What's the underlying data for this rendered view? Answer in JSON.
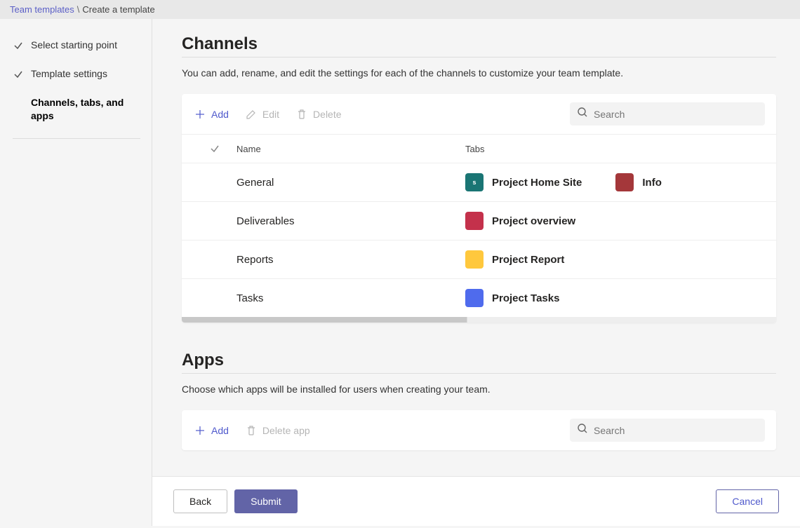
{
  "breadcrumb": {
    "root": "Team templates",
    "separator": "\\",
    "current": "Create a template"
  },
  "sidebar": {
    "steps": [
      {
        "label": "Select starting point",
        "done": true,
        "active": false
      },
      {
        "label": "Template settings",
        "done": true,
        "active": false
      },
      {
        "label": "Channels, tabs, and apps",
        "done": false,
        "active": true
      }
    ]
  },
  "channels": {
    "title": "Channels",
    "description": "You can add, rename, and edit the settings for each of the channels to customize your team template.",
    "toolbar": {
      "add": "Add",
      "edit": "Edit",
      "delete": "Delete",
      "search_placeholder": "Search"
    },
    "columns": {
      "name": "Name",
      "tabs": "Tabs"
    },
    "rows": [
      {
        "name": "General",
        "tabs": [
          {
            "label": "Project Home Site",
            "icon_color": "teal",
            "icon_glyph": "s"
          },
          {
            "label": "Info",
            "icon_color": "brown",
            "icon_glyph": ""
          }
        ]
      },
      {
        "name": "Deliverables",
        "tabs": [
          {
            "label": "Project overview",
            "icon_color": "red",
            "icon_glyph": ""
          }
        ]
      },
      {
        "name": "Reports",
        "tabs": [
          {
            "label": "Project Report",
            "icon_color": "yellow",
            "icon_glyph": ""
          }
        ]
      },
      {
        "name": "Tasks",
        "tabs": [
          {
            "label": "Project Tasks",
            "icon_color": "blue",
            "icon_glyph": ""
          }
        ]
      }
    ]
  },
  "apps": {
    "title": "Apps",
    "description": "Choose which apps will be installed for users when creating your team.",
    "toolbar": {
      "add": "Add",
      "delete": "Delete app",
      "search_placeholder": "Search"
    }
  },
  "footer": {
    "back": "Back",
    "submit": "Submit",
    "cancel": "Cancel"
  }
}
